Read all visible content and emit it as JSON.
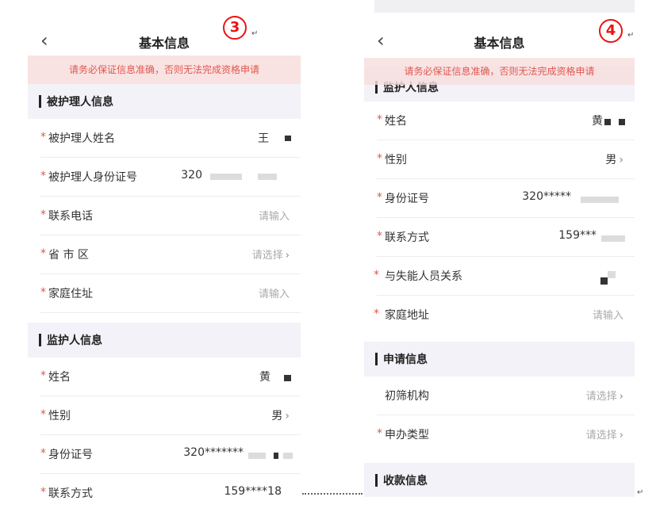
{
  "left": {
    "badge": "3",
    "title": "基本信息",
    "notice": "请务必保证信息准确，否则无法完成资格申请",
    "sections": [
      {
        "title": "被护理人信息"
      },
      {
        "title": "监护人信息"
      }
    ],
    "rows": [
      {
        "label": "被护理人姓名",
        "value": "王"
      },
      {
        "label": "被护理人身份证号",
        "value": "320"
      },
      {
        "label": "联系电话",
        "value": "请输入"
      },
      {
        "label": "省 市 区",
        "value": "请选择"
      },
      {
        "label": "家庭住址",
        "value": "请输入"
      },
      {
        "label": "姓名",
        "value": "黄"
      },
      {
        "label": "性别",
        "value": "男"
      },
      {
        "label": "身份证号",
        "value": "320*******"
      },
      {
        "label": "联系方式",
        "value": "159****18"
      }
    ]
  },
  "right": {
    "badge": "4",
    "title": "基本信息",
    "notice": "请务必保证信息准确，否则无法完成资格申请",
    "sections": [
      {
        "title": "监护人信息"
      },
      {
        "title": "申请信息"
      },
      {
        "title": "收款信息"
      }
    ],
    "rows": [
      {
        "label": "姓名",
        "value": "黄"
      },
      {
        "label": "性别",
        "value": "男"
      },
      {
        "label": "身份证号",
        "value": "320*****"
      },
      {
        "label": "联系方式",
        "value": "159***"
      },
      {
        "label": "与失能人员关系",
        "value": ""
      },
      {
        "label": "家庭地址",
        "value": "请输入"
      },
      {
        "label": "初筛机构",
        "value": "请选择"
      },
      {
        "label": "申办类型",
        "value": "请选择"
      }
    ]
  },
  "icons": {
    "back": "chevron-left-icon",
    "chevron": "chevron-right-icon",
    "return": "return-mark-icon"
  },
  "colors": {
    "required": "#e0584f",
    "notice_bg": "#f9e2e2",
    "section_bg": "#f2f2f8",
    "badge": "#e11111"
  }
}
